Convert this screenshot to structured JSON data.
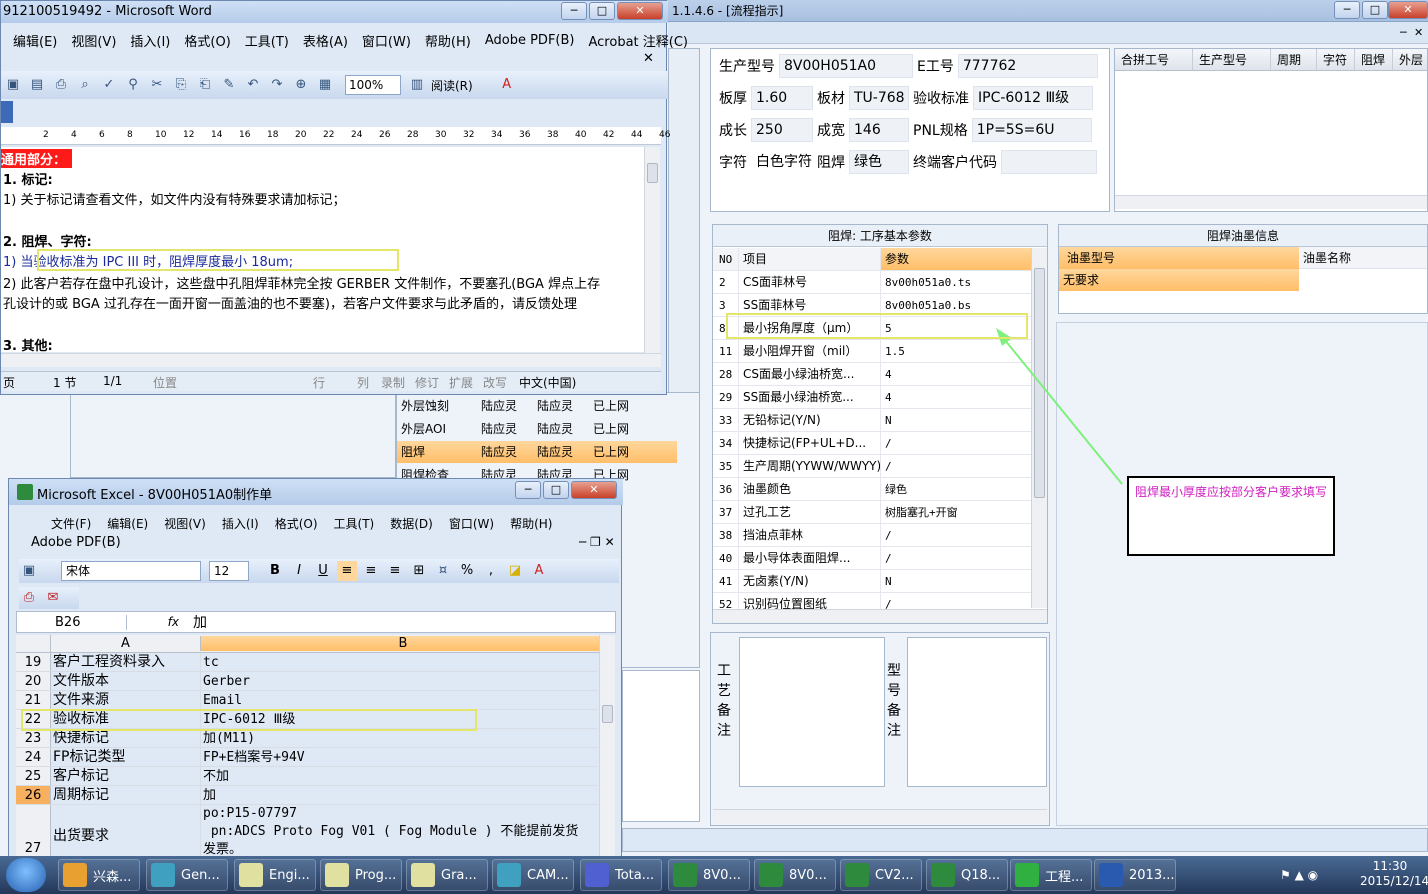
{
  "bg_app": {
    "title": "1.1.4.6 - [流程指示]",
    "info": {
      "model_label": "生产型号",
      "model_value": "8V00H051A0",
      "e_label": "E工号",
      "e_value": "777762",
      "thickness_label": "板厚",
      "thickness_value": "1.60",
      "material_label": "板材",
      "material_value": "TU-768",
      "standard_label": "验收标准",
      "standard_value": "IPC-6012 Ⅲ级",
      "length_label": "成长",
      "length_value": "250",
      "width_label": "成宽",
      "width_value": "146",
      "pnl_label": "PNL规格",
      "pnl_value": "1P=5S=6U",
      "char_label": "字符",
      "char_value": "白色字符",
      "mask_label": "阻焊",
      "mask_value": "绿色",
      "customer_label": "终端客户代码",
      "customer_value": ""
    },
    "merge_grid_headers": [
      "合拼工号",
      "生产型号",
      "周期",
      "字符",
      "阻焊",
      "外层"
    ],
    "process_rows": [
      {
        "name": "外层蚀刻",
        "a": "陆应灵",
        "b": "陆应灵",
        "c": "已上网",
        "selected": false
      },
      {
        "name": "外层AOI",
        "a": "陆应灵",
        "b": "陆应灵",
        "c": "已上网",
        "selected": false
      },
      {
        "name": "阻焊",
        "a": "陆应灵",
        "b": "陆应灵",
        "c": "已上网",
        "selected": true
      },
      {
        "name": "阻焊检查",
        "a": "陆应灵",
        "b": "陆应灵",
        "c": "已上网",
        "selected": false
      }
    ],
    "param_section_title": "阻焊: 工序基本参数",
    "param_headers": {
      "no": "NO",
      "item": "项目",
      "value": "参数"
    },
    "params": [
      {
        "no": "2",
        "item": "CS面菲林号",
        "value": "8v00h051a0.ts"
      },
      {
        "no": "3",
        "item": "SS面菲林号",
        "value": "8v00h051a0.bs"
      },
      {
        "no": "8",
        "item": "最小拐角厚度（μm）",
        "value": "5"
      },
      {
        "no": "11",
        "item": "最小阻焊开窗（mil）",
        "value": "1.5"
      },
      {
        "no": "28",
        "item": "CS面最小绿油桥宽...",
        "value": "4"
      },
      {
        "no": "29",
        "item": "SS面最小绿油桥宽...",
        "value": "4"
      },
      {
        "no": "33",
        "item": "无铅标记(Y/N)",
        "value": "N"
      },
      {
        "no": "34",
        "item": "快捷标记(FP+UL+D...",
        "value": "/"
      },
      {
        "no": "35",
        "item": "生产周期(YYWW/WWYY)",
        "value": "/"
      },
      {
        "no": "36",
        "item": "油墨颜色",
        "value": "绿色"
      },
      {
        "no": "37",
        "item": "过孔工艺",
        "value": "树脂塞孔+开窗"
      },
      {
        "no": "38",
        "item": "挡油点菲林",
        "value": "/"
      },
      {
        "no": "40",
        "item": "最小导体表面阻焊...",
        "value": "/"
      },
      {
        "no": "41",
        "item": "无卤素(Y/N)",
        "value": "N"
      },
      {
        "no": "52",
        "item": "识别码位置图纸",
        "value": "/"
      }
    ],
    "ink_section_title": "阻焊油墨信息",
    "ink_headers": [
      "油墨型号",
      "油墨名称"
    ],
    "ink_rows": [
      {
        "model": "无要求",
        "name": ""
      }
    ],
    "process_note_label": "工艺备注",
    "model_note_label": "型号备注",
    "annotation": "阻焊最小厚度应按部分客户要求填写"
  },
  "word": {
    "title": "912100519492 - Microsoft Word",
    "menu": [
      "编辑(E)",
      "视图(V)",
      "插入(I)",
      "格式(O)",
      "工具(T)",
      "表格(A)",
      "窗口(W)",
      "帮助(H)",
      "Adobe PDF(B)",
      "Acrobat 注释(C)"
    ],
    "zoom": "100%",
    "read_label": "阅读(R)",
    "ruler": [
      "2",
      "4",
      "6",
      "8",
      "10",
      "12",
      "14",
      "16",
      "18",
      "20",
      "22",
      "24",
      "26",
      "28",
      "30",
      "32",
      "34",
      "36",
      "38",
      "40",
      "42",
      "44",
      "46"
    ],
    "lines": [
      {
        "text": "通用部分：",
        "style": "red"
      },
      {
        "text": "1. 标记:",
        "style": "bold"
      },
      {
        "text": "1) 关于标记请查看文件，如文件内没有特殊要求请加标记；",
        "style": "normal"
      },
      {
        "text": "",
        "style": "normal"
      },
      {
        "text": "2. 阻焊、字符:",
        "style": "bold"
      },
      {
        "text": "1) 当验收标准为 IPC III 时，阻焊厚度最小 18um;",
        "style": "blue"
      },
      {
        "text": "2) 此客户若存在盘中孔设计，这些盘中孔阻焊菲林完全按 GERBER 文件制作，不要塞孔(BGA 焊点上存",
        "style": "normal"
      },
      {
        "text": "   孔设计的或 BGA 过孔存在一面开窗一面盖油的也不要塞)，若客户文件要求与此矛盾的，请反馈处理",
        "style": "normal"
      },
      {
        "text": "",
        "style": "normal"
      },
      {
        "text": "3. 其他:",
        "style": "bold"
      }
    ],
    "status": {
      "page": "页",
      "section": "1 节",
      "pages": "1/1",
      "position": "位置",
      "line": "行",
      "col": "列",
      "rec": "录制",
      "trk": "修订",
      "ext": "扩展",
      "ovr": "改写",
      "lang": "中文(中国)"
    }
  },
  "excel": {
    "title": "Microsoft Excel - 8V00H051A0制作单",
    "menu": [
      "文件(F)",
      "编辑(E)",
      "视图(V)",
      "插入(I)",
      "格式(O)",
      "工具(T)",
      "数据(D)",
      "窗口(W)",
      "帮助(H)"
    ],
    "menu2": "Adobe PDF(B)",
    "font": "宋体",
    "font_size": "12",
    "cell_ref": "B26",
    "fx": "fx",
    "formula": "加",
    "col_a": "A",
    "col_b": "B",
    "rows": [
      {
        "n": "19",
        "a": "客户工程资料录入",
        "b": "tc",
        "hl": false
      },
      {
        "n": "20",
        "a": "文件版本",
        "b": "Gerber",
        "hl": false
      },
      {
        "n": "21",
        "a": "文件来源",
        "b": "Email",
        "hl": false
      },
      {
        "n": "22",
        "a": "验收标准",
        "b": "IPC-6012 Ⅲ级",
        "hl": false
      },
      {
        "n": "23",
        "a": "快捷标记",
        "b": "加(M11)",
        "hl": false
      },
      {
        "n": "24",
        "a": "FP标记类型",
        "b": "FP+E档案号+94V",
        "hl": false
      },
      {
        "n": "25",
        "a": "客户标记",
        "b": "不加",
        "hl": false
      },
      {
        "n": "26",
        "a": "周期标记",
        "b": "加",
        "hl": true
      }
    ],
    "row27": {
      "n": "27",
      "a": "出货要求",
      "b1": "po:P15-07797",
      "b2": " pn:ADCS Proto Fog V01 ( Fog Module ) 不能提前发货",
      "b3": "发票。"
    }
  },
  "taskbar": {
    "items": [
      "兴森...",
      "Gen...",
      "Engi...",
      "Prog...",
      "Gra...",
      "CAM...",
      "Tota...",
      "8V0...",
      "8V0...",
      "CV2...",
      "Q18...",
      "工程...",
      "2013..."
    ],
    "time": "11:30",
    "date": "2015/12/14"
  },
  "colors": {
    "accent": "#ffbe68",
    "highlight": "#e4e66a",
    "annotation_text": "#d020c0",
    "arrow": "#7ef07e"
  }
}
